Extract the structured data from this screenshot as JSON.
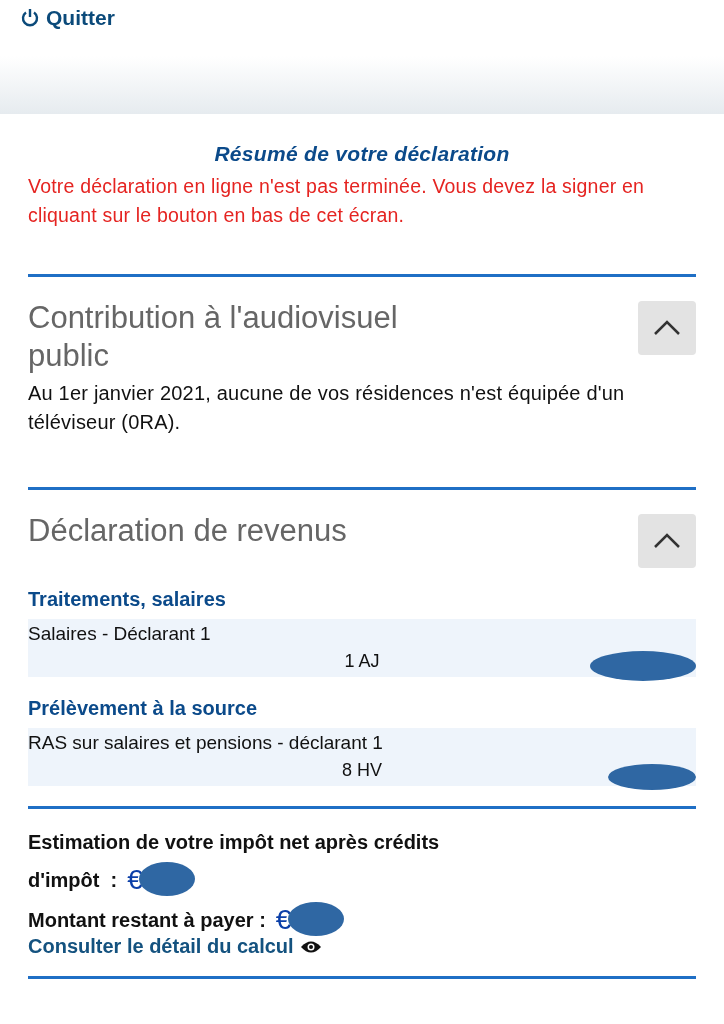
{
  "quit_button": {
    "label": "Quitter"
  },
  "summary_title": "Résumé de votre déclaration",
  "warning": "Votre déclaration en ligne n'est pas terminée. Vous devez la signer en cliquant sur le bouton en bas de cet écran.",
  "sections": [
    {
      "title": "Contribution à l'audiovisuel public",
      "expanded": true,
      "text": "Au 1er janvier 2021, aucune de vos résidences n'est équipée d'un téléviseur (0RA)."
    },
    {
      "title": "Déclaration de revenus",
      "expanded": true,
      "groups": [
        {
          "heading": "Traitements, salaires",
          "rows": [
            {
              "label": "Salaires - Déclarant 1",
              "code": "1 AJ"
            }
          ]
        },
        {
          "heading": "Prélèvement à la source",
          "rows": [
            {
              "label": "RAS sur salaires et pensions - déclarant 1",
              "code": "8 HV"
            }
          ]
        }
      ]
    }
  ],
  "totals": [
    {
      "label_lines": [
        "Estimation de votre impôt net après crédits",
        "d'impôt  :"
      ],
      "currency": "€"
    },
    {
      "label_lines": [
        "Montant restant à payer :"
      ],
      "currency": "€"
    }
  ],
  "detail_link": "Consulter le détail du calcul"
}
